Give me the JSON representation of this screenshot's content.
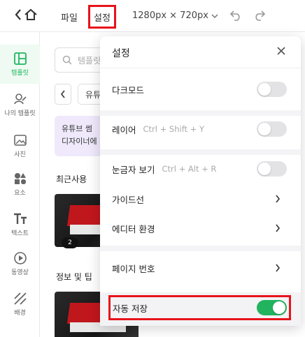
{
  "topbar": {
    "file_label": "파일",
    "settings_label": "설정",
    "canvas_size": "1280px × 720px"
  },
  "sidebar": {
    "items": [
      {
        "label": "템플릿",
        "icon": "template-icon",
        "active": true
      },
      {
        "label": "나의 템플릿",
        "icon": "my-template-icon"
      },
      {
        "label": "사진",
        "icon": "photo-icon"
      },
      {
        "label": "요소",
        "icon": "elements-icon"
      },
      {
        "label": "텍스트",
        "icon": "text-icon"
      },
      {
        "label": "동영상",
        "icon": "video-icon"
      },
      {
        "label": "배경",
        "icon": "background-icon"
      }
    ]
  },
  "panel": {
    "search_placeholder": "템플릿",
    "chip_label": "유튜",
    "promo_line1": "유튜브 썸",
    "promo_line2": "디자이너에",
    "recent_title": "최근사용",
    "info_title": "정보 및 팁",
    "badge": "2"
  },
  "settings_popup": {
    "title": "설정",
    "dark_mode": {
      "label": "다크모드",
      "on": false
    },
    "layer": {
      "label": "레이어",
      "shortcut": "Ctrl + Shift + Y",
      "on": false
    },
    "ruler": {
      "label": "눈금자 보기",
      "shortcut": "Ctrl + Alt + R",
      "on": false
    },
    "guides": {
      "label": "가이드선"
    },
    "editor_env": {
      "label": "에디터 환경"
    },
    "page_number": {
      "label": "페이지 번호"
    },
    "autosave": {
      "label": "자동 저장",
      "on": true
    }
  },
  "colors": {
    "accent_green": "#22b35f",
    "highlight_red": "#e8131a"
  }
}
